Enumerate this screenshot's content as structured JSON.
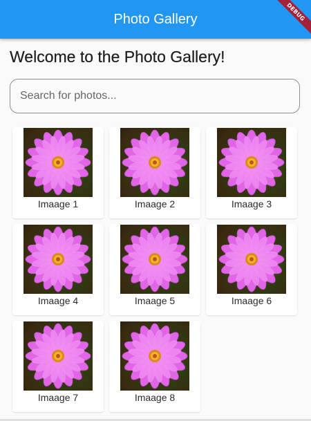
{
  "appbar": {
    "title": "Photo Gallery",
    "debug_label": "DEBUG",
    "color": "#2196f3"
  },
  "heading": "Welcome to the Photo Gallery!",
  "search": {
    "placeholder": "Search for photos...",
    "value": ""
  },
  "gallery": {
    "items": [
      {
        "caption": "Imaage 1",
        "icon": "flower-photo"
      },
      {
        "caption": "Imaage 2",
        "icon": "flower-photo"
      },
      {
        "caption": "Imaage 3",
        "icon": "flower-photo"
      },
      {
        "caption": "Imaage 4",
        "icon": "flower-photo"
      },
      {
        "caption": "Imaage 5",
        "icon": "flower-photo"
      },
      {
        "caption": "Imaage 6",
        "icon": "flower-photo"
      },
      {
        "caption": "Imaage 7",
        "icon": "flower-photo"
      },
      {
        "caption": "Imaage 8",
        "icon": "flower-photo"
      }
    ]
  }
}
